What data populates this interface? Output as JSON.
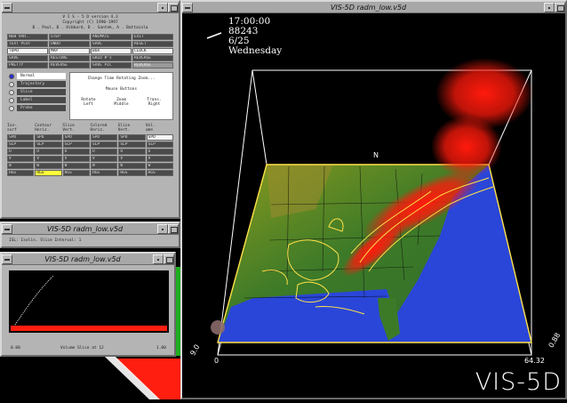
{
  "control_window": {
    "title": "",
    "header_lines": [
      "V I S - 5 D  version 4.3",
      "Copyright (C) 1990-1997",
      "B . Paul, B . Hibbard, D . Santek, A . Battaiola"
    ],
    "button_grid": [
      [
        "NEW VAR..",
        "STEP",
        "ANIMATE",
        "EXIT"
      ],
      [
        "TEXT PLOT",
        "UNDO",
        "SAVE",
        "RESET"
      ],
      [
        "TOPO",
        "MAP",
        "BOX",
        "CLOCK"
      ],
      [
        "SAVE",
        "RESTORE",
        "GRID #'s",
        "REVERSE"
      ],
      [
        "PRETTY",
        "REVERSE",
        "SAVE PIC",
        "REVERSE"
      ]
    ],
    "radio_items": [
      {
        "label": "Normal",
        "selected": true
      },
      {
        "label": "Trajectory",
        "selected": false
      },
      {
        "label": "Slice",
        "selected": false
      },
      {
        "label": "Label",
        "selected": false
      },
      {
        "label": "Probe",
        "selected": false
      }
    ],
    "info_panel": {
      "line1": "Change Time Rotating Zoom...",
      "line2": "Mouse  Buttons",
      "col1": [
        "Rotate",
        "Left"
      ],
      "col2": [
        "Zoom",
        "Middle"
      ],
      "col3": [
        "Trans.",
        "Right"
      ]
    },
    "table_headers": [
      "Iso-",
      "Contour",
      "Slice",
      "Colored",
      "Slice",
      "Vol."
    ],
    "table_subheaders": [
      "surf",
      "Horiz.",
      "Vert.",
      "Horiz.",
      "Vert.",
      "ume"
    ],
    "var_grid": [
      [
        "SPD",
        "SPD",
        "SPD",
        "SPD",
        "SPD",
        "SPD"
      ],
      [
        "SLP",
        "SLP",
        "SLP",
        "SLP",
        "SLP",
        "SLP"
      ],
      [
        "U",
        "U",
        "U",
        "U",
        "U",
        "U"
      ],
      [
        "V",
        "V",
        "V",
        "V",
        "V",
        "V"
      ],
      [
        "W",
        "W",
        "W",
        "W",
        "W",
        "W"
      ],
      [
        "HGS",
        "HGS",
        "HGS",
        "HGS",
        "HGS",
        "HGS"
      ]
    ]
  },
  "small_window": {
    "title": "VIS-5D  radm_low.v5d",
    "text": "ISL: Isolin. Slice Interval: 1"
  },
  "graph_window": {
    "title": "VIS-5D  radm_low.v5d",
    "footer_left": "0.00",
    "footer_mid": "Volume Slice at 12",
    "footer_right": "1.00"
  },
  "main_window": {
    "title": "VIS-5D  radm_low.v5d",
    "time": "17:00:00",
    "number": "88243",
    "date": "6/25",
    "weekday": "Wednesday",
    "north_label": "N",
    "axis_x0": "0",
    "axis_x1": "64.32",
    "axis_y0": "9.0",
    "axis_z": "0.88",
    "logo": "VIS-5D"
  },
  "colors": {
    "window_gray": "#b4b4b4",
    "land_green": "#3f7a2a",
    "ocean_blue": "#2a46d8",
    "plume_red": "#ff1a0c",
    "contour_yellow": "#ffe24a"
  }
}
